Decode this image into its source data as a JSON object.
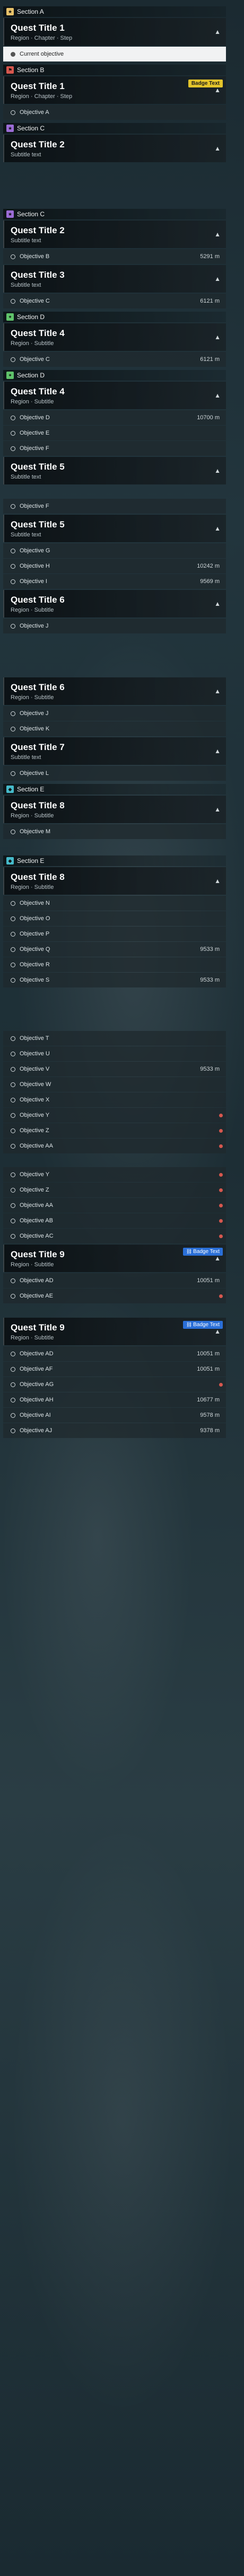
{
  "sections": [
    {
      "type": "header",
      "label": "Section A",
      "color": "#e8c26a",
      "icon": "star-icon"
    },
    {
      "type": "quest",
      "title": "Quest Title 1",
      "sub": "Region · Chapter · Step"
    },
    {
      "type": "objective",
      "label": "Current objective",
      "highlighted": true
    },
    {
      "type": "header",
      "label": "Section B",
      "color": "#d6574e",
      "icon": "flag-icon"
    },
    {
      "type": "quest",
      "title": "Quest Title 1",
      "sub": "Region · Chapter · Step",
      "badge": "Badge Text",
      "badge_style": "yellow"
    },
    {
      "type": "objective",
      "label": "Objective A"
    },
    {
      "type": "header",
      "label": "Section C",
      "color": "#9b6cd6",
      "icon": "star-icon"
    },
    {
      "type": "quest",
      "title": "Quest Title 2",
      "sub": "Subtitle text"
    },
    {
      "type": "gap",
      "size": "lg"
    },
    {
      "type": "header",
      "label": "Section C",
      "color": "#9b6cd6",
      "icon": "star-icon"
    },
    {
      "type": "quest",
      "title": "Quest Title 2",
      "sub": "Subtitle text"
    },
    {
      "type": "objective",
      "label": "Objective B",
      "dist": "5291 m"
    },
    {
      "type": "quest",
      "title": "Quest Title 3",
      "sub": "Subtitle text"
    },
    {
      "type": "objective",
      "label": "Objective C",
      "dist": "6121 m"
    },
    {
      "type": "header",
      "label": "Section D",
      "color": "#5fc26a",
      "icon": "leaf-icon"
    },
    {
      "type": "quest",
      "title": "Quest Title 4",
      "sub": "Region · Subtitle"
    },
    {
      "type": "objective",
      "label": "Objective C",
      "dist": "6121 m"
    },
    {
      "type": "header",
      "label": "Section D",
      "color": "#5fc26a",
      "icon": "leaf-icon"
    },
    {
      "type": "quest",
      "title": "Quest Title 4",
      "sub": "Region · Subtitle"
    },
    {
      "type": "objective",
      "label": "Objective D",
      "dist": "10700 m"
    },
    {
      "type": "objective",
      "label": "Objective E"
    },
    {
      "type": "objective",
      "label": "Objective F"
    },
    {
      "type": "quest",
      "title": "Quest Title 5",
      "sub": "Subtitle text"
    },
    {
      "type": "gap",
      "size": "sm"
    },
    {
      "type": "objective",
      "label": "Objective F"
    },
    {
      "type": "quest",
      "title": "Quest Title 5",
      "sub": "Subtitle text"
    },
    {
      "type": "objective",
      "label": "Objective G"
    },
    {
      "type": "objective",
      "label": "Objective H",
      "dist": "10242 m"
    },
    {
      "type": "objective",
      "label": "Objective I",
      "dist": "9569 m"
    },
    {
      "type": "quest",
      "title": "Quest Title 6",
      "sub": "Region · Subtitle"
    },
    {
      "type": "objective",
      "label": "Objective J"
    },
    {
      "type": "gap",
      "size": "lg"
    },
    {
      "type": "quest",
      "title": "Quest Title 6",
      "sub": "Region · Subtitle"
    },
    {
      "type": "objective",
      "label": "Objective J"
    },
    {
      "type": "objective",
      "label": "Objective K"
    },
    {
      "type": "quest",
      "title": "Quest Title 7",
      "sub": "Subtitle text"
    },
    {
      "type": "objective",
      "label": "Objective L"
    },
    {
      "type": "header",
      "label": "Section E",
      "color": "#45b9c9",
      "icon": "drop-icon"
    },
    {
      "type": "quest",
      "title": "Quest Title 8",
      "sub": "Region · Subtitle"
    },
    {
      "type": "objective",
      "label": "Objective M"
    },
    {
      "type": "gap",
      "size": "sm"
    },
    {
      "type": "header",
      "label": "Section E",
      "color": "#45b9c9",
      "icon": "drop-icon"
    },
    {
      "type": "quest",
      "title": "Quest Title 8",
      "sub": "Region · Subtitle"
    },
    {
      "type": "objective",
      "label": "Objective N"
    },
    {
      "type": "objective",
      "label": "Objective O"
    },
    {
      "type": "objective",
      "label": "Objective P"
    },
    {
      "type": "objective",
      "label": "Objective Q",
      "dist": "9533 m"
    },
    {
      "type": "objective",
      "label": "Objective R"
    },
    {
      "type": "objective",
      "label": "Objective S",
      "dist": "9533 m"
    },
    {
      "type": "gap",
      "size": "lg"
    },
    {
      "type": "objective",
      "label": "Objective T"
    },
    {
      "type": "objective",
      "label": "Objective U"
    },
    {
      "type": "objective",
      "label": "Objective V",
      "dist": "9533 m"
    },
    {
      "type": "objective",
      "label": "Objective W"
    },
    {
      "type": "objective",
      "label": "Objective X"
    },
    {
      "type": "objective",
      "label": "Objective Y",
      "dot": true
    },
    {
      "type": "objective",
      "label": "Objective Z",
      "dot": true
    },
    {
      "type": "objective",
      "label": "Objective AA",
      "dot": true
    },
    {
      "type": "gap",
      "size": "sm"
    },
    {
      "type": "objective",
      "label": "Objective Y",
      "dot": true
    },
    {
      "type": "objective",
      "label": "Objective Z",
      "dot": true
    },
    {
      "type": "objective",
      "label": "Objective AA",
      "dot": true
    },
    {
      "type": "objective",
      "label": "Objective AB",
      "dot": true
    },
    {
      "type": "objective",
      "label": "Objective AC",
      "dot": true
    },
    {
      "type": "quest",
      "title": "Quest Title 9",
      "sub": "Region · Subtitle",
      "badge": "Badge Text",
      "badge_style": "blue",
      "badge_icon": "link-icon"
    },
    {
      "type": "objective",
      "label": "Objective AD",
      "dist": "10051 m"
    },
    {
      "type": "objective",
      "label": "Objective AE",
      "dot": true
    },
    {
      "type": "gap",
      "size": "sm"
    },
    {
      "type": "quest",
      "title": "Quest Title 9",
      "sub": "Region · Subtitle",
      "badge": "Badge Text",
      "badge_style": "blue",
      "badge_icon": "link-icon"
    },
    {
      "type": "objective",
      "label": "Objective AD",
      "dist": "10051 m"
    },
    {
      "type": "objective",
      "label": "Objective AF",
      "dist": "10051 m"
    },
    {
      "type": "objective",
      "label": "Objective AG",
      "dot": true
    },
    {
      "type": "objective",
      "label": "Objective AH",
      "dist": "10677 m"
    },
    {
      "type": "objective",
      "label": "Objective AI",
      "dist": "9578 m"
    },
    {
      "type": "objective",
      "label": "Objective AJ",
      "dist": "9378 m"
    }
  ]
}
